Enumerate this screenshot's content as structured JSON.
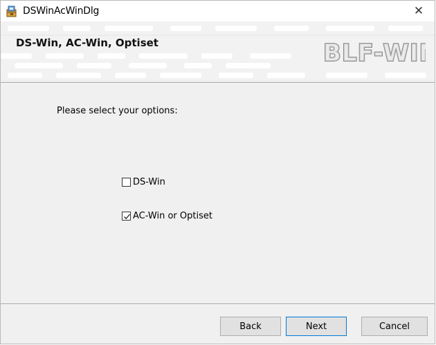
{
  "window": {
    "title": "DSWinAcWinDlg",
    "close_glyph": "✕"
  },
  "banner": {
    "title": "DS-Win, AC-Win, Optiset",
    "logo_text": "BLF-WIN"
  },
  "content": {
    "prompt": "Please select your options:",
    "options": [
      {
        "label": "DS-Win",
        "checked": false
      },
      {
        "label": "AC-Win or Optiset",
        "checked": true
      }
    ]
  },
  "buttons": {
    "back": "Back",
    "next": "Next",
    "cancel": "Cancel"
  },
  "colors": {
    "dialog_bg": "#f0f0f0",
    "default_button_border": "#0078d7"
  },
  "icons": {
    "app": "installer-icon",
    "close": "close-icon",
    "check": "checkmark-icon"
  }
}
